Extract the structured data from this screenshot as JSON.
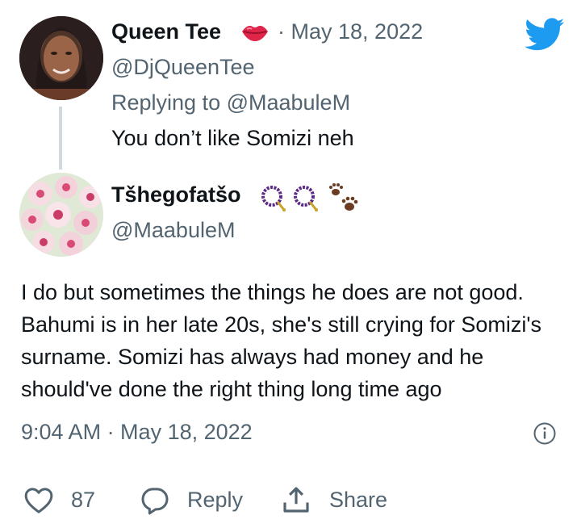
{
  "reply_tweet": {
    "display_name": "Queen Tee",
    "name_emoji": "lips-icon",
    "separator": "·",
    "date": "May 18, 2022",
    "handle": "@DjQueenTee",
    "replying_prefix": "Replying to ",
    "replying_to": "@MaabuleM",
    "text": "You don’t like Somizi neh"
  },
  "main_tweet": {
    "display_name": "Tšhegofatšo",
    "name_emojis": [
      "prayer-beads-icon",
      "prayer-beads-icon",
      "paw-prints-icon"
    ],
    "handle": "@MaabuleM",
    "text": "I do but sometimes the things he does are not good. Bahumi is in her late 20s, she's still crying for Somizi's surname. Somizi has always had money and he should've done the right thing long time ago",
    "timestamp": "9:04 AM · May 18, 2022"
  },
  "actions": {
    "like_count": "87",
    "reply_label": "Reply",
    "share_label": "Share"
  },
  "colors": {
    "twitter_blue": "#1d9bf0",
    "secondary_text": "#536471",
    "primary_text": "#0f1419"
  }
}
